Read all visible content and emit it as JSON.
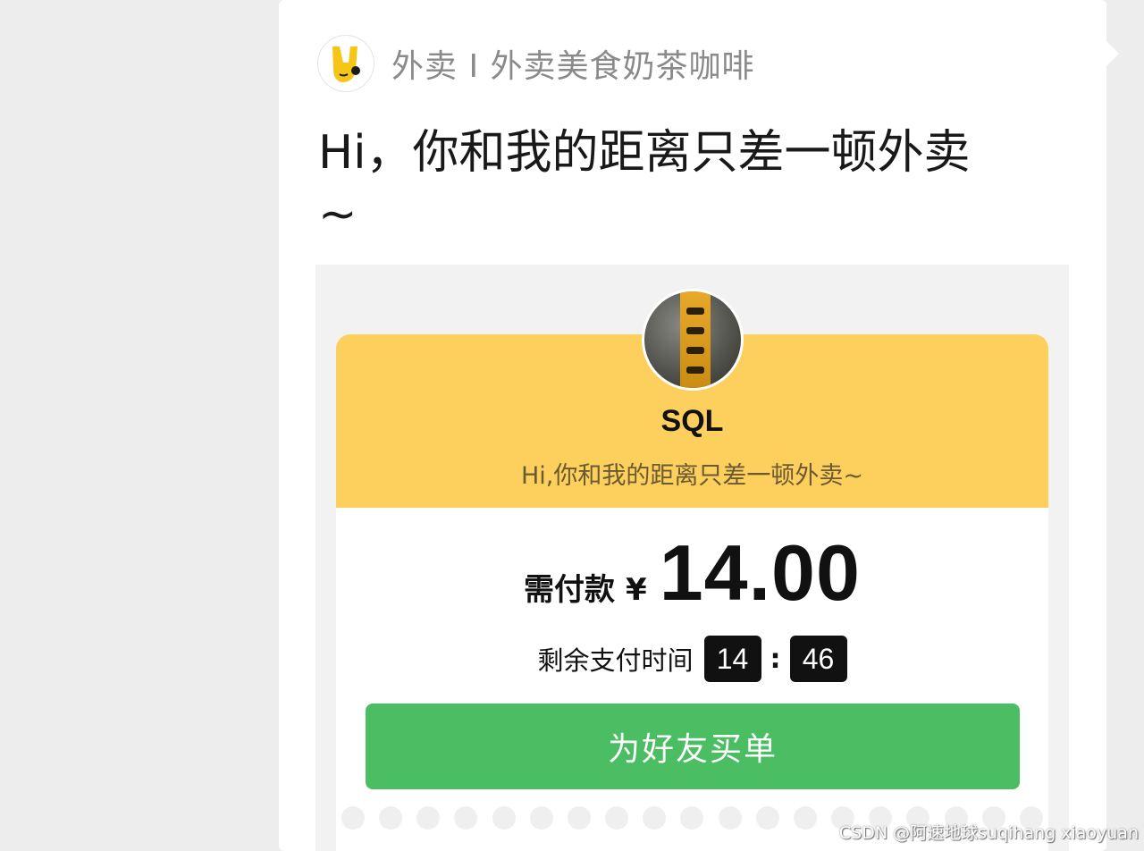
{
  "source": {
    "app_icon": "yellow-kangaroo-icon",
    "name": "外卖 I 外卖美食奶茶咖啡"
  },
  "message": {
    "title": "Hi，你和我的距离只差一顿外卖",
    "title_tail": "~"
  },
  "order": {
    "shop_avatar": "shop-avatar-image",
    "shop_name": "SQL",
    "slogan": "Hi,你和我的距离只差一顿外卖~",
    "pay_label": "需付款",
    "currency": "¥",
    "amount": "14.00",
    "timer_label": "剩余支付时间",
    "timer_minutes": "14",
    "timer_separator": ":",
    "timer_seconds": "46",
    "button_label": "为好友买单"
  },
  "watermark": "CSDN @阿速地球suqihang xiaoyuan",
  "colors": {
    "header_yellow": "#fdcf5c",
    "button_green": "#4bbd63",
    "background": "#ededed"
  }
}
